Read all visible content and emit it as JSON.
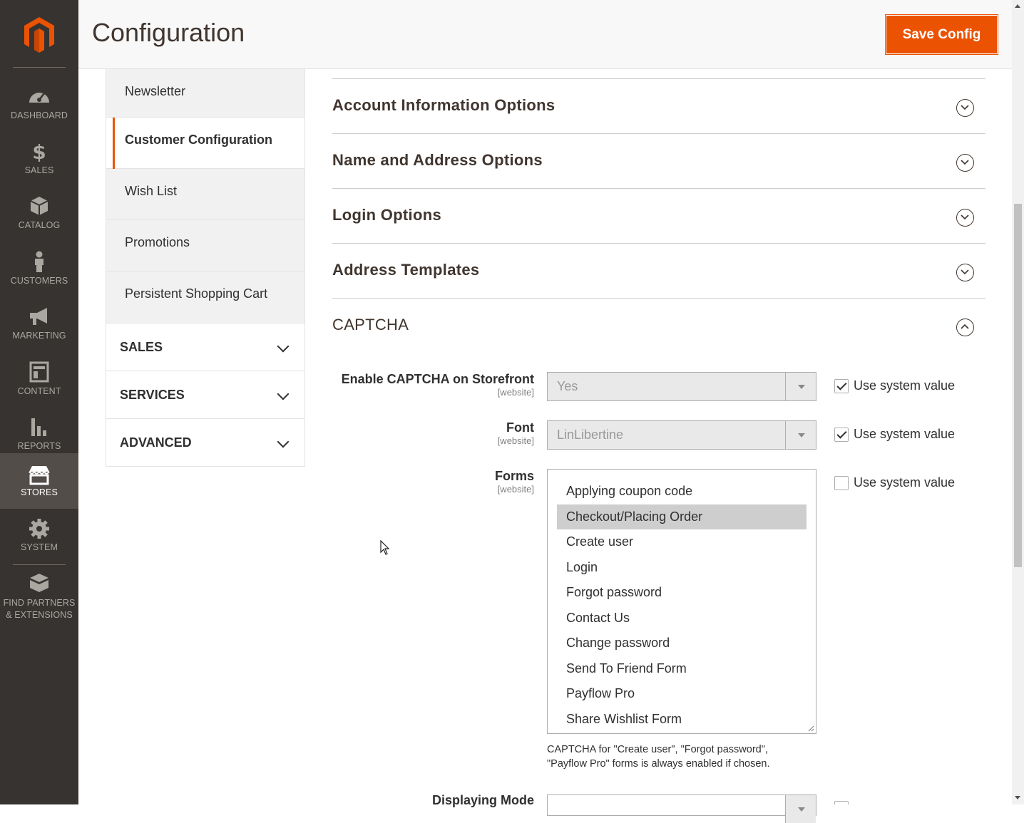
{
  "nav": {
    "items": [
      {
        "label": "DASHBOARD",
        "icon": "dashboard-icon"
      },
      {
        "label": "SALES",
        "icon": "dollar-icon"
      },
      {
        "label": "CATALOG",
        "icon": "box-icon"
      },
      {
        "label": "CUSTOMERS",
        "icon": "person-icon"
      },
      {
        "label": "MARKETING",
        "icon": "megaphone-icon"
      },
      {
        "label": "CONTENT",
        "icon": "layout-icon"
      },
      {
        "label": "REPORTS",
        "icon": "bar-chart-icon"
      },
      {
        "label": "STORES",
        "icon": "store-icon",
        "active": true
      },
      {
        "label": "SYSTEM",
        "icon": "gear-icon"
      },
      {
        "label": "FIND PARTNERS & EXTENSIONS",
        "icon": "blocks-icon"
      }
    ]
  },
  "header": {
    "title": "Configuration",
    "save_label": "Save Config"
  },
  "tabs": {
    "items": [
      "Newsletter",
      "Customer Configuration",
      "Wish List",
      "Promotions",
      "Persistent Shopping Cart"
    ],
    "current": "Customer Configuration",
    "blocks": [
      "SALES",
      "SERVICES",
      "ADVANCED"
    ]
  },
  "sections": [
    "Account Information Options",
    "Name and Address Options",
    "Login Options",
    "Address Templates",
    "CAPTCHA"
  ],
  "captcha": {
    "enable": {
      "label": "Enable CAPTCHA on Storefront",
      "scope": "[website]",
      "value": "Yes",
      "use_system": true
    },
    "font": {
      "label": "Font",
      "scope": "[website]",
      "value": "LinLibertine",
      "use_system": true
    },
    "forms": {
      "label": "Forms",
      "scope": "[website]",
      "use_system": false,
      "options": [
        "Applying coupon code",
        "Checkout/Placing Order",
        "Create user",
        "Login",
        "Forgot password",
        "Contact Us",
        "Change password",
        "Send To Friend Form",
        "Payflow Pro",
        "Share Wishlist Form"
      ],
      "selected": "Checkout/Placing Order",
      "note": "CAPTCHA for \"Create user\", \"Forgot password\", \"Payflow Pro\" forms is always enabled if chosen."
    },
    "display_mode": {
      "label": "Displaying Mode"
    },
    "use_system_label": "Use system value"
  },
  "colors": {
    "accent": "#eb5202",
    "nav_bg": "#373330",
    "nav_active": "#524d49"
  }
}
